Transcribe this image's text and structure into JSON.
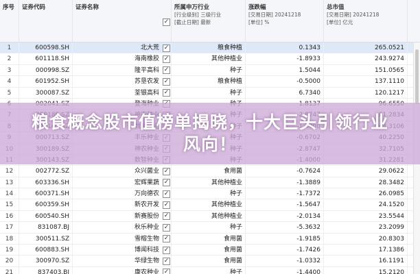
{
  "header": {
    "col_num": "序号",
    "col_code": "证券代码",
    "col_name": "证券名称",
    "col_check": "✓",
    "col_industry": "所属申万行业",
    "col_industry_sub1": "[行业级别] 三级行业",
    "col_industry_sub2": "[截止日期] 最新",
    "col_change": "涨跌幅",
    "col_change_sub1": "[交易日期] 20241218",
    "col_change_sub2": "[单位] %",
    "col_cap": "总市值",
    "col_cap_sub1": "[交易日期] 20241218",
    "col_cap_sub2": "[单位] 亿元"
  },
  "rows": [
    {
      "num": "1",
      "code": "600598.SH",
      "name": "北大荒",
      "check": "✓",
      "industry": "粮食种植",
      "change": "0.1343",
      "cap": "265.0521"
    },
    {
      "num": "2",
      "code": "601118.SH",
      "name": "海南橡胶",
      "check": "✓",
      "industry": "其他种植业",
      "change": "-1.8933",
      "cap": "243.9274"
    },
    {
      "num": "3",
      "code": "000998.SZ",
      "name": "隆平高科",
      "check": "✓",
      "industry": "种子",
      "change": "1.5044",
      "cap": "151.0565"
    },
    {
      "num": "4",
      "code": "601952.SH",
      "name": "苏垦农发",
      "check": "✓",
      "industry": "粮食种植",
      "change": "-0.5000",
      "cap": "137.1110"
    },
    {
      "num": "5",
      "code": "300087.SZ",
      "name": "荃银高科",
      "check": "✓",
      "industry": "种子",
      "change": "6.7340",
      "cap": "120.1217"
    },
    {
      "num": "6",
      "code": "002041.SZ",
      "name": "登海种业",
      "check": "✓",
      "industry": "种子",
      "change": "1.8137",
      "cap": "96.6550"
    },
    {
      "num": "7",
      "code": "300189.SZ",
      "name": "神农种业",
      "check": "✓",
      "industry": "种子",
      "change": "-2.8747",
      "cap": "61.2834"
    },
    {
      "num": "8",
      "code": "300143.SZ",
      "name": "数智种业",
      "check": "✓",
      "industry": "种子",
      "change": "-1.4000",
      "cap": "44.3106"
    },
    {
      "num": "9",
      "code": "000713.SZ",
      "name": "丰乐种业",
      "check": "✓",
      "industry": "种子",
      "change": "-0.6702",
      "cap": "40.2250"
    },
    {
      "num": "10",
      "code": "300189.SZ",
      "name": "神农种业",
      "check": "✓",
      "industry": "种子",
      "change": "-2.8747",
      "cap": "32.7105"
    },
    {
      "num": "11",
      "code": "300143.SZ",
      "name": "数智种业",
      "check": "✓",
      "industry": "种子",
      "change": "-1.4000",
      "cap": "31.2281"
    },
    {
      "num": "12",
      "code": "002772.SZ",
      "name": "众兴菌业",
      "check": "✓",
      "industry": "食用菌",
      "change": "-0.7624",
      "cap": "29.0622"
    },
    {
      "num": "13",
      "code": "603336.SH",
      "name": "宏辉果蔬",
      "check": "✓",
      "industry": "其他种植业",
      "change": "-1.3889",
      "cap": "28.3482"
    },
    {
      "num": "14",
      "code": "600371.SH",
      "name": "万向德农",
      "check": "✓",
      "industry": "种子",
      "change": "-1.7372",
      "cap": "26.0985"
    },
    {
      "num": "15",
      "code": "600359.SH",
      "name": "新农开发",
      "check": "✓",
      "industry": "其他种植业",
      "change": "-1.5647",
      "cap": "24.1520"
    },
    {
      "num": "16",
      "code": "600540.SH",
      "name": "新赛股份",
      "check": "✓",
      "industry": "其他种植业",
      "change": "-2.0134",
      "cap": "23.5544"
    },
    {
      "num": "17",
      "code": "831087.BJ",
      "name": "秋乐种业",
      "check": "✓",
      "industry": "种子",
      "change": "-5.3632",
      "cap": "23.2099"
    },
    {
      "num": "18",
      "code": "300511.SZ",
      "name": "雪榕生物",
      "check": "✓",
      "industry": "食用菌",
      "change": "-1.9185",
      "cap": "20.8303"
    },
    {
      "num": "19",
      "code": "600883.SH",
      "name": "博闻科技",
      "check": "✓",
      "industry": "食用菌",
      "change": "-1.7426",
      "cap": "17.1386"
    },
    {
      "num": "20",
      "code": "300970.SZ",
      "name": "华绿生物",
      "check": "✓",
      "industry": "食用菌",
      "change": "-1.0332",
      "cap": "16.1191"
    },
    {
      "num": "21",
      "code": "837403.BJ",
      "name": "康农种业",
      "check": "✓",
      "industry": "种子",
      "change": "-1.4400",
      "cap": "15.2120"
    }
  ],
  "overlay_text": "粮食概念股市值榜单揭晓，十大巨头引领行业风向！",
  "colors": {
    "selected_row": "#dfe8f7",
    "header_bg": "#f4f6f9",
    "overlay": "#cdaad7"
  }
}
